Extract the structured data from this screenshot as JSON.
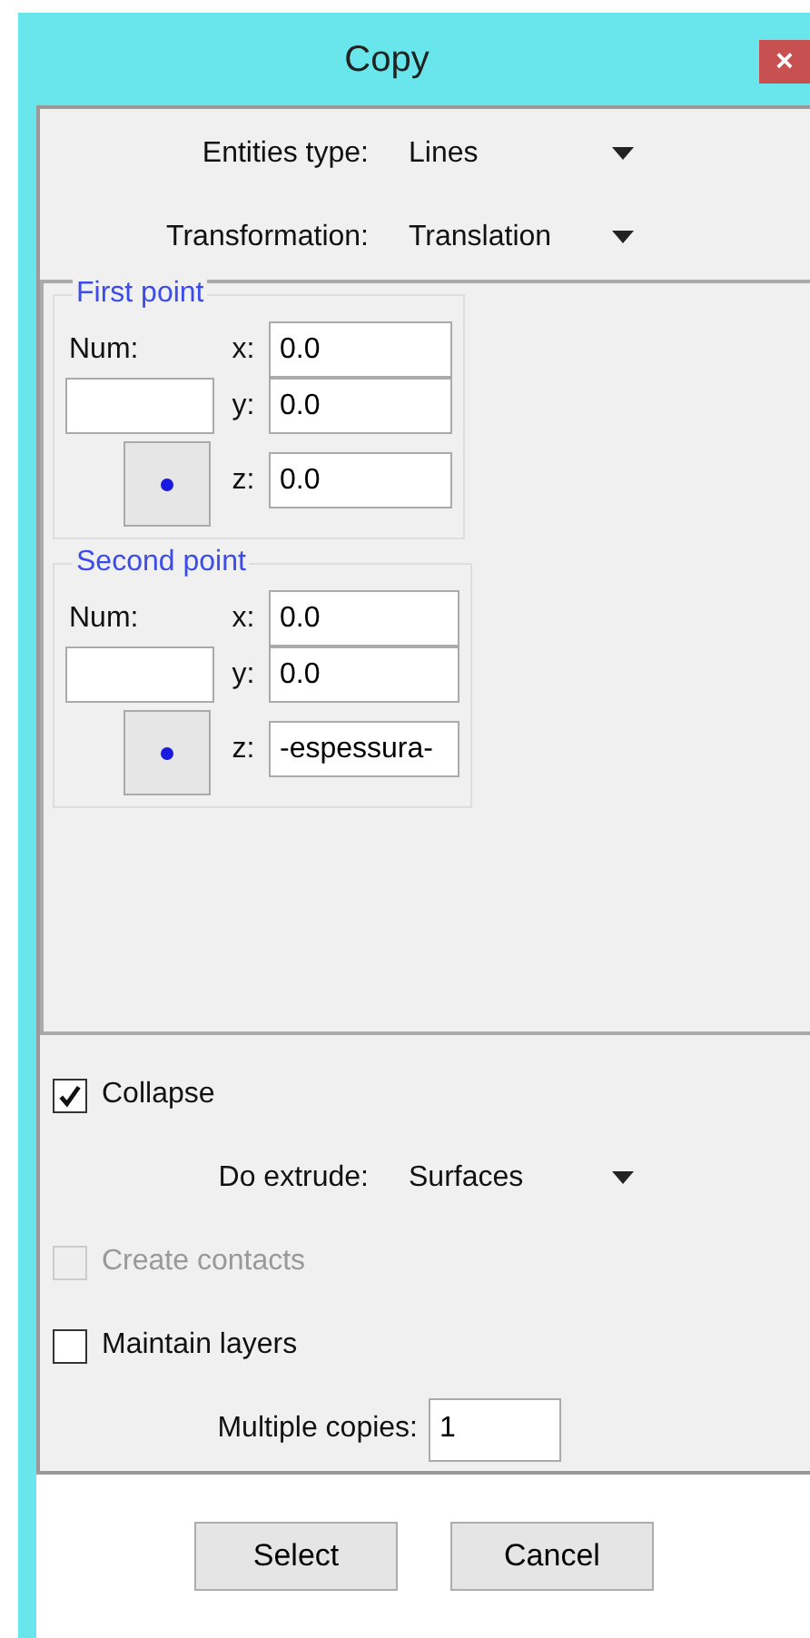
{
  "window": {
    "title": "Copy",
    "close": "×"
  },
  "selects": [
    {
      "label": "Entities type:",
      "value": "Lines"
    },
    {
      "label": "Transformation:",
      "value": "Translation"
    }
  ],
  "points": [
    {
      "title": "First point",
      "num_label": "Num:",
      "coords": [
        {
          "label": "x:",
          "value": "0.0"
        },
        {
          "label": "y:",
          "value": "0.0"
        },
        {
          "label": "z:",
          "value": "0.0"
        }
      ]
    },
    {
      "title": "Second point",
      "num_label": "Num:",
      "coords": [
        {
          "label": "x:",
          "value": "0.0"
        },
        {
          "label": "y:",
          "value": "0.0"
        },
        {
          "label": "z:",
          "value": "-espessura-"
        }
      ]
    }
  ],
  "options": [
    {
      "kind": "checkbox",
      "label": "Collapse",
      "checked": true,
      "disabled": false
    },
    {
      "kind": "select",
      "label": "Do extrude:",
      "value": "Surfaces"
    },
    {
      "kind": "checkbox",
      "label": "Create contacts",
      "checked": false,
      "disabled": true
    },
    {
      "kind": "checkbox",
      "label": "Maintain layers",
      "checked": false,
      "disabled": false
    },
    {
      "kind": "input",
      "label": "Multiple copies:",
      "value": "1"
    }
  ],
  "buttons": [
    "Select",
    "Cancel"
  ]
}
